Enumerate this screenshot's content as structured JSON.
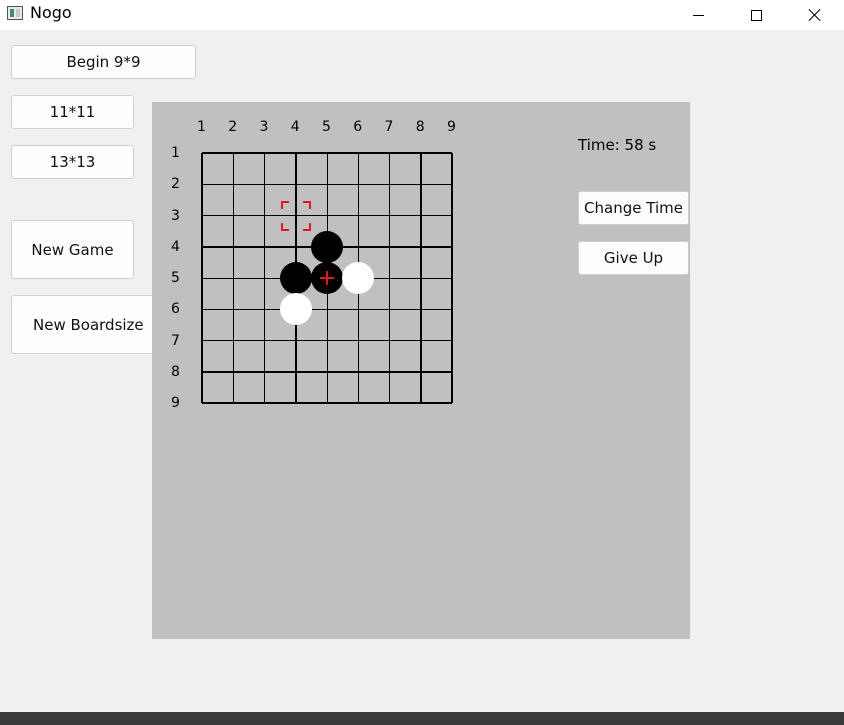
{
  "window": {
    "title": "Nogo",
    "icon": "app-window-icon",
    "controls": [
      "minimize-icon",
      "maximize-icon",
      "close-icon"
    ]
  },
  "left_buttons": {
    "begin_9": "Begin 9*9",
    "size_11": "11*11",
    "size_13": "13*13",
    "new_game": "New Game",
    "new_boardsize": "New Boardsize"
  },
  "board": {
    "size": 9,
    "col_labels": [
      "1",
      "2",
      "3",
      "4",
      "5",
      "6",
      "7",
      "8",
      "9"
    ],
    "row_labels": [
      "1",
      "2",
      "3",
      "4",
      "5",
      "6",
      "7",
      "8",
      "9"
    ],
    "stones": [
      {
        "row": 4,
        "col": 5,
        "color": "black"
      },
      {
        "row": 5,
        "col": 4,
        "color": "black"
      },
      {
        "row": 5,
        "col": 5,
        "color": "black"
      },
      {
        "row": 5,
        "col": 6,
        "color": "white"
      },
      {
        "row": 6,
        "col": 4,
        "color": "white"
      }
    ],
    "last_move": {
      "row": 5,
      "col": 5
    },
    "hover": {
      "row": 3,
      "col": 4
    },
    "marker_color": "#e01818"
  },
  "side_panel": {
    "time_label": "Time: 58 s",
    "change_time": "Change Time",
    "give_up": "Give Up"
  }
}
